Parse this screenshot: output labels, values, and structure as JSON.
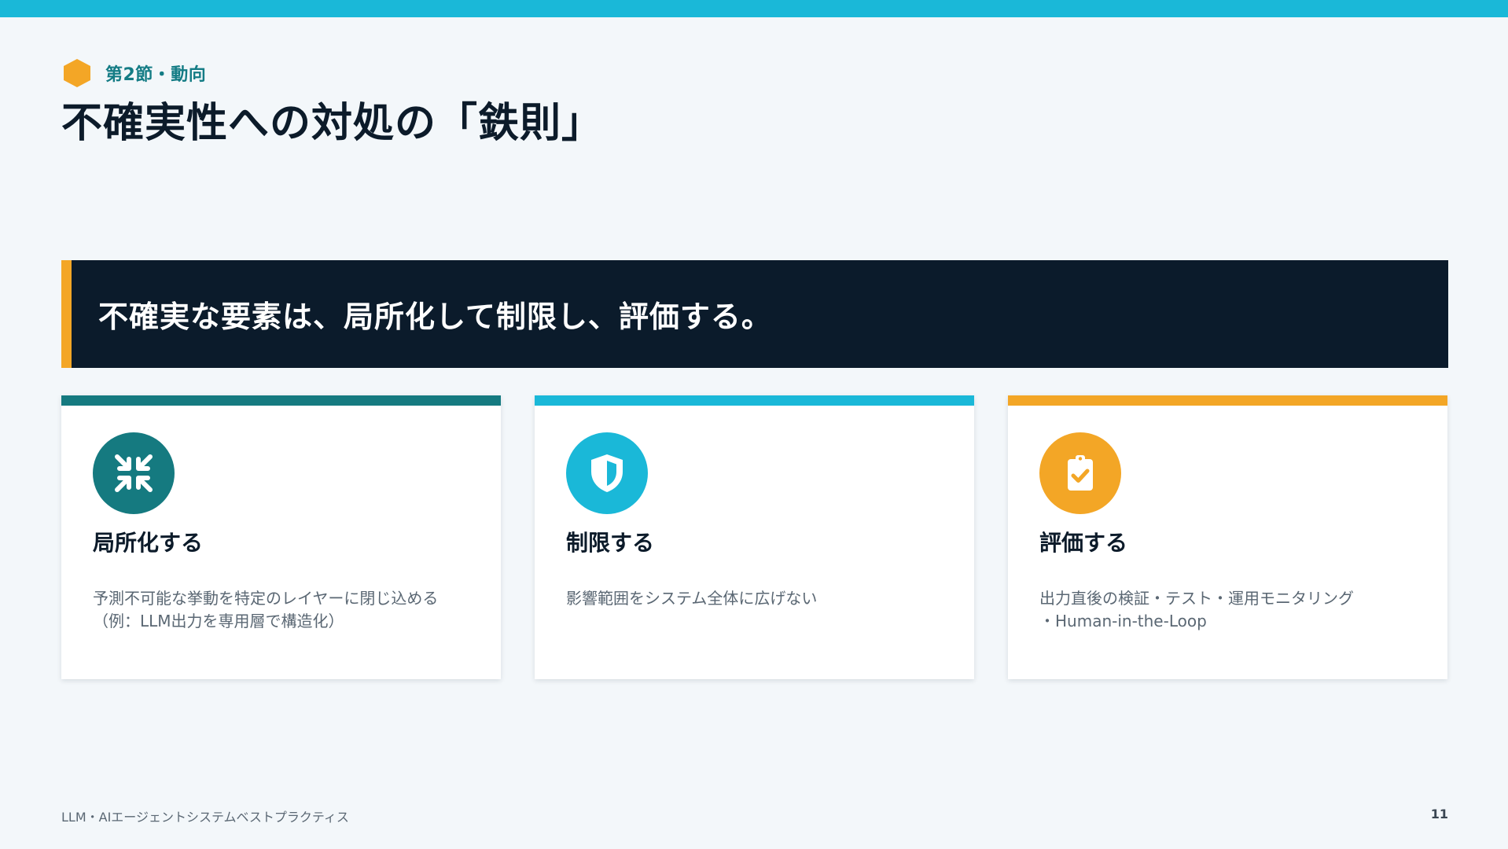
{
  "header": {
    "section_label": "第2節・動向",
    "title": "不確実性への対処の「鉄則」"
  },
  "banner": {
    "text": "不確実な要素は、局所化して制限し、評価する。"
  },
  "cards": [
    {
      "icon": "compress-arrows-icon",
      "accent_color": "#157a80",
      "title": "局所化する",
      "desc_lines": [
        "予測不可能な挙動を特定のレイヤーに閉じ込める",
        "（例：LLM出力を専用層で構造化）"
      ]
    },
    {
      "icon": "shield-icon",
      "accent_color": "#1ab8d8",
      "title": "制限する",
      "desc_lines": [
        "影響範囲をシステム全体に広げない",
        ""
      ]
    },
    {
      "icon": "clipboard-check-icon",
      "accent_color": "#f3a626",
      "title": "評価する",
      "desc_lines": [
        "出力直後の検証・テスト・運用モニタリング",
        "・Human-in-the-Loop"
      ]
    }
  ],
  "footer": {
    "left": "LLM・AIエージェントシステムベストプラクティス",
    "page_number": "11"
  },
  "colors": {
    "top_bar": "#1ab8d8",
    "banner_bg": "#0b1b2b",
    "banner_accent": "#f3a626",
    "section_hex": "#f3a626",
    "section_label": "#147c85"
  }
}
